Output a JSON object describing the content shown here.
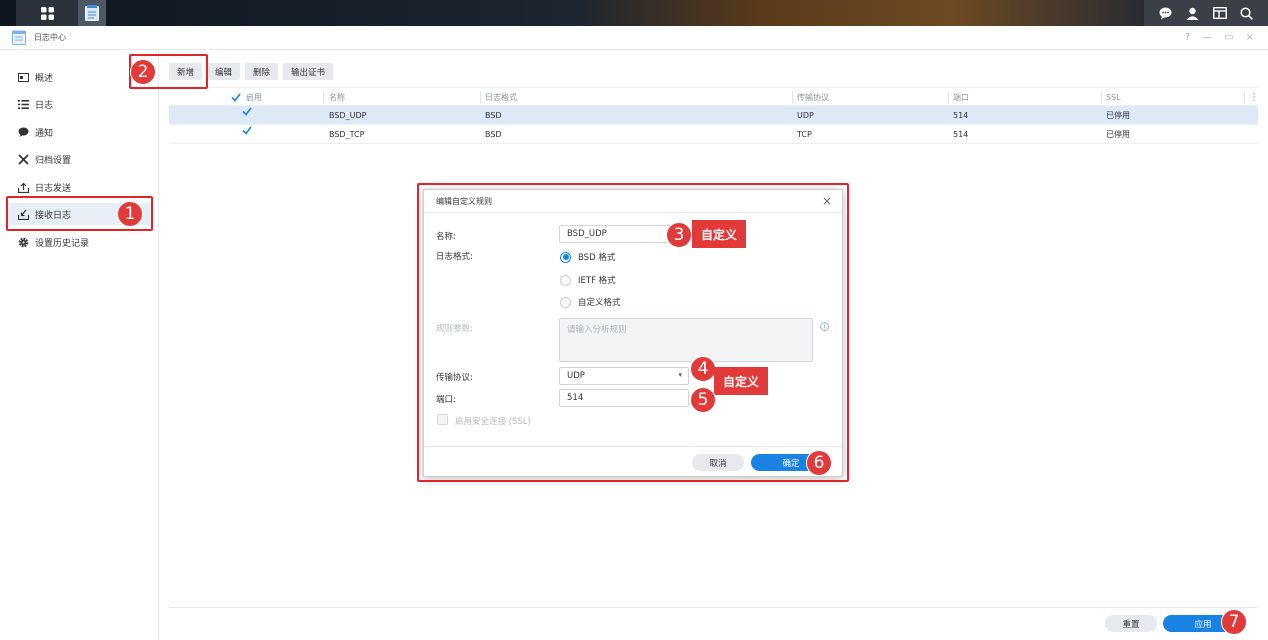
{
  "window": {
    "title": "日志中心",
    "controls": [
      "?",
      "—",
      "▭",
      "×"
    ]
  },
  "sidebar": {
    "items": [
      {
        "label": "概述",
        "icon": "overview-icon"
      },
      {
        "label": "日志",
        "icon": "list-icon"
      },
      {
        "label": "通知",
        "icon": "chat-bubble-icon"
      },
      {
        "label": "归档设置",
        "icon": "tools-icon"
      },
      {
        "label": "日志发送",
        "icon": "upload-icon"
      },
      {
        "label": "接收日志",
        "icon": "download-tray-icon"
      },
      {
        "label": "设置历史记录",
        "icon": "gear-icon"
      }
    ]
  },
  "toolbar": {
    "create": "新增",
    "edit": "编辑",
    "delete": "删除",
    "export_cert": "输出证书"
  },
  "table": {
    "headers": [
      "启用",
      "名称",
      "日志格式",
      "传输协议",
      "端口",
      "SSL"
    ],
    "rows": [
      {
        "enabled": true,
        "name": "BSD_UDP",
        "format": "BSD",
        "protocol": "UDP",
        "port": "514",
        "ssl": "已停用"
      },
      {
        "enabled": true,
        "name": "BSD_TCP",
        "format": "BSD",
        "protocol": "TCP",
        "port": "514",
        "ssl": "已停用"
      }
    ]
  },
  "footer": {
    "reset": "重置",
    "apply": "应用"
  },
  "dialog": {
    "title": "编辑自定义规则",
    "name_label": "名称:",
    "name_value": "BSD_UDP",
    "format_label": "日志格式:",
    "format_options": [
      "BSD 格式",
      "IETF 格式",
      "自定义格式"
    ],
    "format_selected": "BSD 格式",
    "rule_label": "规则参数:",
    "rule_placeholder": "请输入分析规则",
    "protocol_label": "传输协议:",
    "protocol_value": "UDP",
    "port_label": "端口:",
    "port_value": "514",
    "ssl_label": "启用安全连接 (SSL)",
    "cancel": "取消",
    "ok": "确定"
  },
  "annotations": {
    "steps": [
      "1",
      "2",
      "3",
      "4",
      "5",
      "6",
      "7"
    ],
    "custom_callouts": [
      "自定义",
      "自定义"
    ]
  },
  "colors": {
    "accent": "#1a82e2",
    "annotation_red": "#e23a3a",
    "selected_row": "#dde9f7"
  }
}
